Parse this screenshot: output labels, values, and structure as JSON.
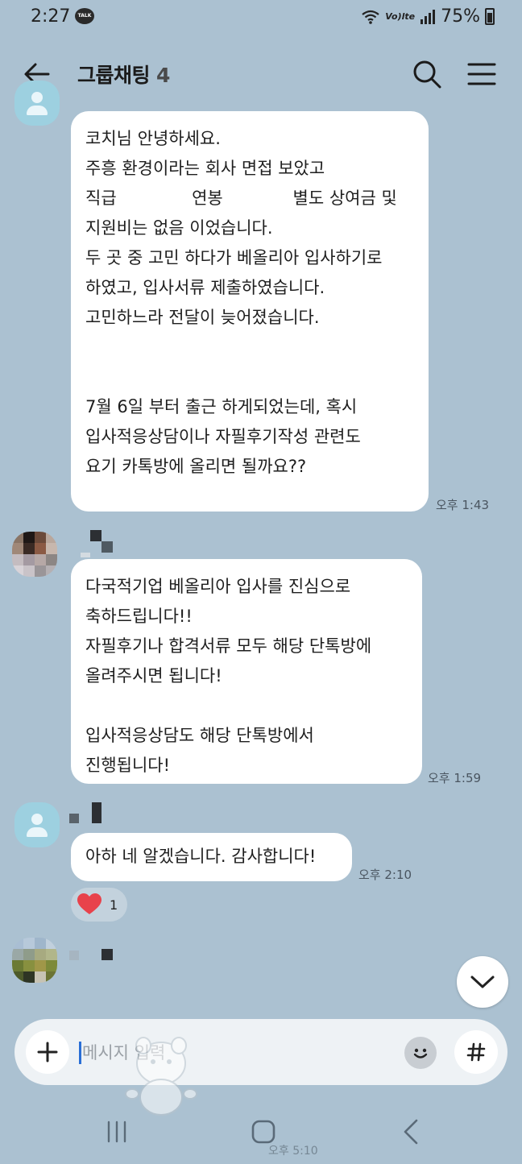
{
  "status_bar": {
    "time": "2:27",
    "talk_badge": "TALK",
    "network": "Vo)lte",
    "battery": "75%"
  },
  "header": {
    "title": "그룹채팅",
    "member_count": "4"
  },
  "messages": [
    {
      "text": "코치님 안녕하세요.\n주흥 환경이라는 회사 면접 보았고\n직급              연봉             별도 상여금 및\n지원비는 없음 이었습니다.\n두 곳 중 고민 하다가 베올리아 입사하기로\n하였고, 입사서류 제출하였습니다.\n고민하느라 전달이 늦어졌습니다.\n\n\n7월 6일 부터 출근 하게되었는데, 혹시\n입사적응상담이나 자필후기작성 관련도\n요기 카톡방에 올리면 될까요??",
      "time": "오후 1:43"
    },
    {
      "text": "다국적기업 베올리아 입사를 진심으로\n축하드립니다!!\n자필후기나 합격서류 모두 해당 단톡방에\n올려주시면 됩니다!\n\n입사적응상담도 해당 단톡방에서\n진행됩니다!",
      "time": "오후 1:59"
    },
    {
      "text": "아하 네 알겠습니다. 감사합니다!",
      "time": "오후 2:10"
    }
  ],
  "reaction": {
    "emoji": "heart",
    "count": "1"
  },
  "input": {
    "placeholder": "메시지 입력"
  },
  "ghost_time": "오후 5:10",
  "colors": {
    "background": "#abc1d1",
    "bubble": "#ffffff",
    "heart": "#e8424b",
    "caret": "#2a6fd6"
  }
}
